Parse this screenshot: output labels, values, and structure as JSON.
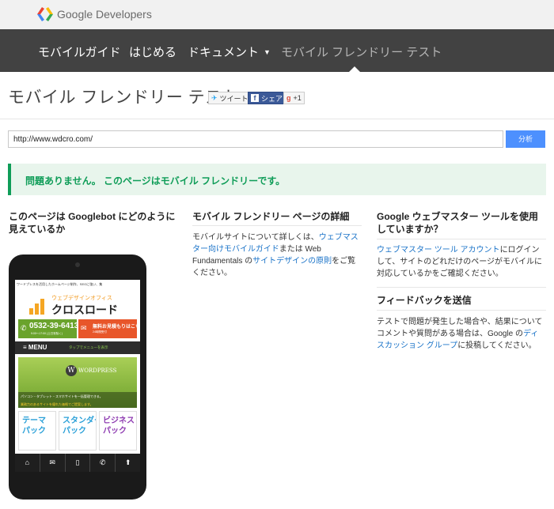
{
  "brand": {
    "name": "Google Developers"
  },
  "nav": {
    "items": [
      {
        "label": "モバイルガイド"
      },
      {
        "label": "はじめる"
      },
      {
        "label": "ドキュメント"
      },
      {
        "label": "モバイル フレンドリー テスト"
      }
    ],
    "active_index": 3
  },
  "page": {
    "title": "モバイル フレンドリー テスト"
  },
  "share": {
    "tweet": "ツイート",
    "facebook": "シェア",
    "gplus": "+1"
  },
  "url_form": {
    "value": "http://www.wdcro.com/",
    "button": "分析"
  },
  "result": {
    "message": "問題ありません。 このページはモバイル フレンドリーです。"
  },
  "col1": {
    "title": "このページは Googlebot にどのように見えているか"
  },
  "col2": {
    "title": "モバイル フレンドリー ページの詳細",
    "text_1": "モバイルサイトについて詳しくは、",
    "link_1": "ウェブマスター向けモバイルガイド",
    "text_2": "または Web Fundamentals の",
    "link_2": "サイトデザインの原則",
    "text_3": "をご覧ください。"
  },
  "col3": {
    "title": "Google ウェブマスター ツールを使用していますか？",
    "link_1": "ウェブマスター ツール アカウント",
    "text_1": "にログインして、サイトのどれだけのページがモバイルに対応しているかをご確認ください。",
    "feedback_title": "フィードバックを送信",
    "text_2": "テストで問題が発生した場合や、結果についてコメントや質問がある場合は、Google の",
    "link_2": "ディスカッション グループ",
    "text_3": "に投稿してください。"
  },
  "preview": {
    "header": "ワードプレスを活用したホームページ制作、SEOに強い、集",
    "logo_sub": "ウェブデザインオフィス",
    "logo_main": "クロスロード",
    "tel": "0532-39-6413",
    "hours": "9:00～17:00 (土日祝除く)",
    "mail_1": "無料お見積もりはこちら",
    "mail_2": "24時間受付",
    "menu": "≡ MENU",
    "menu_hint": "タップでメニューを表示",
    "wp": "WORDPRESS",
    "line_1": "パソコン・タブレット・スマホサイトを一括管理できる。",
    "line_2": "業務力のあるサイトを優れた価格でご提案します。",
    "packs": [
      "テーマ\nパック",
      "スタンダード\nパック",
      "ビジネス\nパック"
    ],
    "footer_icons": [
      "home-icon",
      "mail-icon",
      "mobile-icon",
      "phone-icon",
      "up-arrow-icon"
    ]
  },
  "colors": {
    "nav_bg": "#424242",
    "accent": "#4d90fe",
    "success": "#0f9d58",
    "link": "#1a73c8"
  }
}
